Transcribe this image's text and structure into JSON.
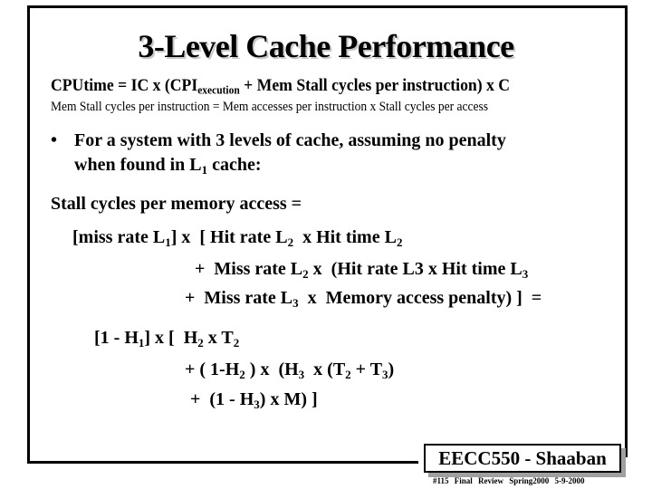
{
  "slide": {
    "title": "3-Level Cache Performance",
    "cpu_equation": {
      "lhs": "CPUtime  =  IC x   (CPI",
      "sub": "execution",
      "rhs": "  +  Mem Stall  cycles per instruction)    x   C"
    },
    "mem_stall_equation": "Mem  Stall cycles per instruction =  Mem accesses per instruction  x  Stall cycles per access",
    "bullet": {
      "marker": "•",
      "line1": "For a system with 3 levels of cache, assuming no penalty",
      "line2_pre": "when found in L",
      "line2_sub": "1",
      "line2_post": " cache:"
    },
    "stall_heading": "Stall cycles per memory access =",
    "formula": {
      "line1": [
        {
          "t": "[miss rate L"
        },
        {
          "s": "1"
        },
        {
          "t": "] x  [ Hit rate L"
        },
        {
          "s": "2"
        },
        {
          "t": "  x Hit time L"
        },
        {
          "s": "2"
        }
      ],
      "line2": [
        {
          "t": "+  Miss rate L"
        },
        {
          "s": "2"
        },
        {
          "t": " x  (Hit rate L3 x Hit time L"
        },
        {
          "s": "3"
        }
      ],
      "line3": [
        {
          "t": "+  Miss rate L"
        },
        {
          "s": "3"
        },
        {
          "t": "  x  Memory access penalty) ]  ="
        }
      ]
    },
    "expansion": {
      "line1": [
        {
          "t": "[1 - H"
        },
        {
          "s": "1"
        },
        {
          "t": "] x [  H"
        },
        {
          "s": "2"
        },
        {
          "t": " x T"
        },
        {
          "s": "2"
        }
      ],
      "line2": [
        {
          "t": "+ ( 1-H"
        },
        {
          "s": "2"
        },
        {
          "t": " ) x  (H"
        },
        {
          "s": "3"
        },
        {
          "t": "  x (T"
        },
        {
          "s": "2"
        },
        {
          "t": " + T"
        },
        {
          "s": "3"
        },
        {
          "t": ")"
        }
      ],
      "line3": [
        {
          "t": "+  (1 - H"
        },
        {
          "s": "3"
        },
        {
          "t": ") x M) ]"
        }
      ]
    }
  },
  "footer": {
    "course": "EECC550 - Shaaban",
    "slide_number": "#115",
    "lecture": "Final Review",
    "term": "Spring2000",
    "date": "5-9-2000"
  }
}
